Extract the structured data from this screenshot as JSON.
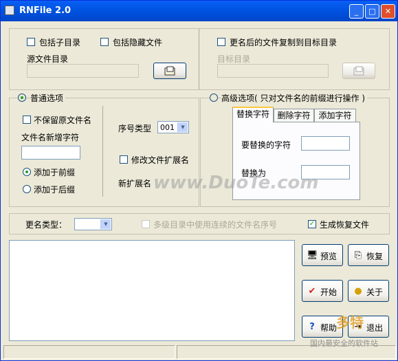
{
  "window": {
    "title": "RNFile 2.0",
    "minimize": "_",
    "maximize": "□",
    "close": "✕"
  },
  "source": {
    "include_subdirs": "包括子目录",
    "include_hidden": "包括隐藏文件",
    "dir_label": "源文件目录",
    "dir_value": ""
  },
  "target": {
    "copy_after_rename": "更名后的文件复制到目标目录",
    "dir_label": "目标目录",
    "dir_value": ""
  },
  "normal": {
    "title": "普通选项",
    "not_keep_name": "不保留原文件名",
    "new_chars_label": "文件名新增字符",
    "new_chars_value": "",
    "add_prefix": "添加于前缀",
    "add_suffix": "添加于后缀",
    "seq_type_label": "序号类型",
    "seq_type_value": "001",
    "modify_ext": "修改文件扩展名",
    "new_ext_label": "新扩展名"
  },
  "advanced": {
    "title": "高级选项",
    "note": "( 只对文件名的前缀进行操作 )",
    "tabs": [
      "替换字符",
      "删除字符",
      "添加字符"
    ],
    "replace_from_label": "要替换的字符",
    "replace_to_label": "替换为"
  },
  "options": {
    "rename_type_label": "更名类型：",
    "multi_dir_seq": "多级目录中使用连续的文件名序号",
    "gen_restore": "生成恢复文件",
    "gen_restore_checked": "✓"
  },
  "buttons": {
    "preview": "预览",
    "restore": "恢复",
    "start": "开始",
    "about": "关于",
    "help": "帮助",
    "exit": "退出"
  },
  "watermark": "www.DuoTe.com",
  "logo": {
    "line1": "多特",
    "line2": "国内最安全的软件站"
  }
}
